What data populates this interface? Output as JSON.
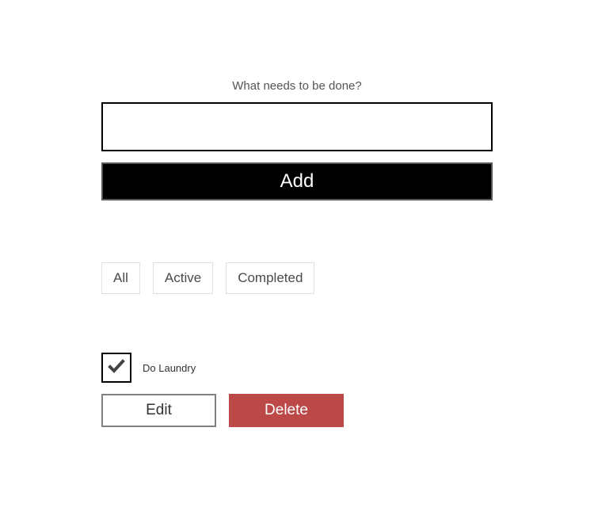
{
  "input": {
    "label": "What needs to be done?",
    "value": "",
    "placeholder": ""
  },
  "buttons": {
    "add": "Add",
    "edit": "Edit",
    "delete": "Delete"
  },
  "filters": [
    {
      "label": "All"
    },
    {
      "label": "Active"
    },
    {
      "label": "Completed"
    }
  ],
  "todos": [
    {
      "label": "Do Laundry",
      "completed": true
    }
  ],
  "colors": {
    "deleteBg": "#bc4848",
    "addBg": "#000000"
  }
}
